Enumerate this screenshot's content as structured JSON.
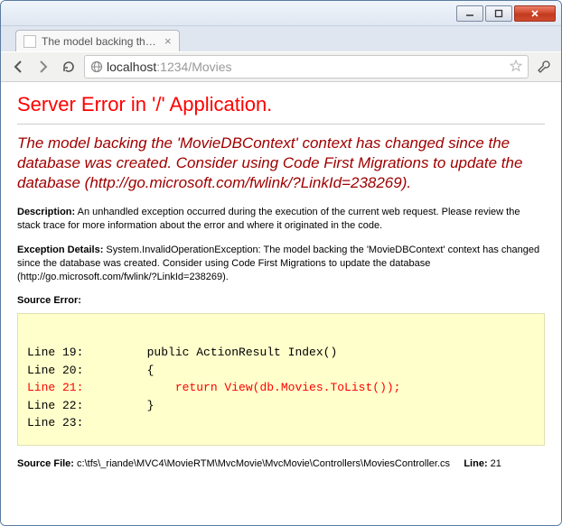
{
  "window": {
    "tab_title": "The model backing the 'M"
  },
  "address": {
    "host": "localhost",
    "port_path": ":1234/Movies"
  },
  "error": {
    "title": "Server Error in '/' Application.",
    "heading": "The model backing the 'MovieDBContext' context has changed since the database was created. Consider using Code First Migrations to update the database (http://go.microsoft.com/fwlink/?LinkId=238269).",
    "description_label": "Description:",
    "description_text": " An unhandled exception occurred during the execution of the current web request. Please review the stack trace for more information about the error and where it originated in the code.",
    "exception_label": "Exception Details:",
    "exception_text": " System.InvalidOperationException: The model backing the 'MovieDBContext' context has changed since the database was created. Consider using Code First Migrations to update the database (http://go.microsoft.com/fwlink/?LinkId=238269).",
    "source_error_label": "Source Error:",
    "code": {
      "l19": "Line 19:         public ActionResult Index()",
      "l20": "Line 20:         {",
      "l21": "Line 21:             return View(db.Movies.ToList());",
      "l22": "Line 22:         }",
      "l23": "Line 23:"
    },
    "source_file_label": "Source File:",
    "source_file_text": " c:\\tfs\\_riande\\MVC4\\MovieRTM\\MvcMovie\\MvcMovie\\Controllers\\MoviesController.cs",
    "line_label": "Line:",
    "line_text": " 21"
  }
}
